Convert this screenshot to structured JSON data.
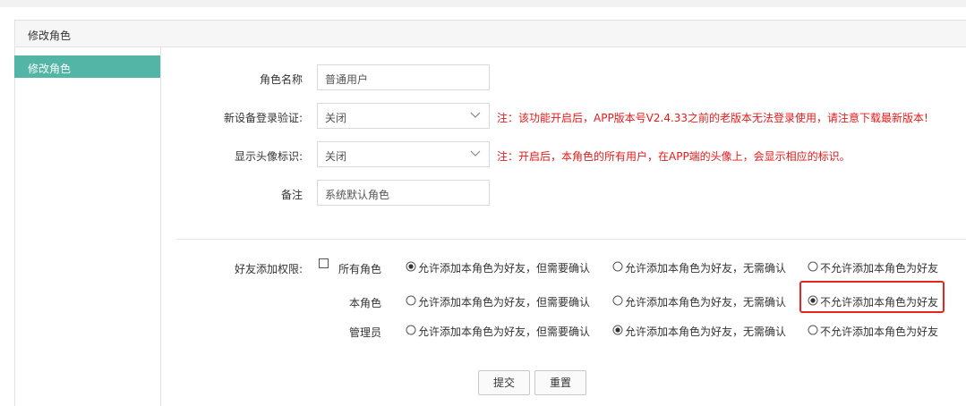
{
  "panel_title": "修改角色",
  "sidebar": {
    "items": [
      {
        "label": "修改角色"
      }
    ]
  },
  "form": {
    "role_name": {
      "label": "角色名称",
      "value": "普通用户"
    },
    "device_verify": {
      "label": "新设备登录验证:",
      "value": "关闭",
      "note": "注：该功能开启后，APP版本号V2.4.33之前的老版本无法登录使用，请注意下载最新版本!"
    },
    "avatar_badge": {
      "label": "显示头像标识:",
      "value": "关闭",
      "note": "注：开启后，本角色的所有用户，在APP端的头像上，会显示相应的标识。"
    },
    "remark": {
      "label": "备注",
      "value": "系统默认角色"
    }
  },
  "friend_permission": {
    "label": "好友添加权限:",
    "all_roles_label": "所有角色",
    "options": [
      "允许添加本角色为好友，但需要确认",
      "允许添加本角色为好友，无需确认",
      "不允许添加本角色为好友"
    ],
    "rows": [
      {
        "name": "所有角色",
        "selected": 0
      },
      {
        "name": "本角色",
        "selected": 2
      },
      {
        "name": "管理员",
        "selected": 1
      }
    ]
  },
  "buttons": {
    "submit": "提交",
    "reset": "重置"
  }
}
